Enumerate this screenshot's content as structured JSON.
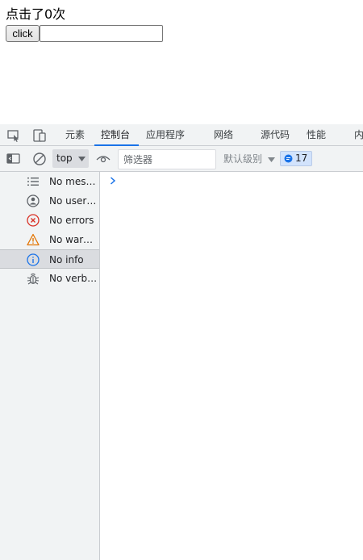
{
  "page": {
    "counter_text": "点击了0次",
    "button_label": "click",
    "input_value": ""
  },
  "devtools": {
    "tabs": [
      {
        "label": "元素",
        "active": false
      },
      {
        "label": "控制台",
        "active": true
      },
      {
        "label": "应用程序",
        "active": false
      },
      {
        "label": "网络",
        "active": false
      },
      {
        "label": "源代码",
        "active": false
      },
      {
        "label": "性能",
        "active": false
      },
      {
        "label": "内",
        "active": false
      }
    ],
    "toolbar": {
      "context": "top",
      "filter_placeholder": "筛选器",
      "levels_label": "默认级别",
      "issues_count": "17"
    },
    "sidebar": {
      "items": [
        {
          "label": "No messages",
          "icon": "list-icon"
        },
        {
          "label": "No user messages",
          "icon": "user-icon"
        },
        {
          "label": "No errors",
          "icon": "error-icon"
        },
        {
          "label": "No warnings",
          "icon": "warning-icon"
        },
        {
          "label": "No info",
          "icon": "info-icon",
          "selected": true
        },
        {
          "label": "No verbose",
          "icon": "bug-icon"
        }
      ]
    }
  },
  "colors": {
    "accent": "#1a73e8",
    "error": "#d93025",
    "warning": "#e37400",
    "panel_bg": "#f1f3f4"
  }
}
